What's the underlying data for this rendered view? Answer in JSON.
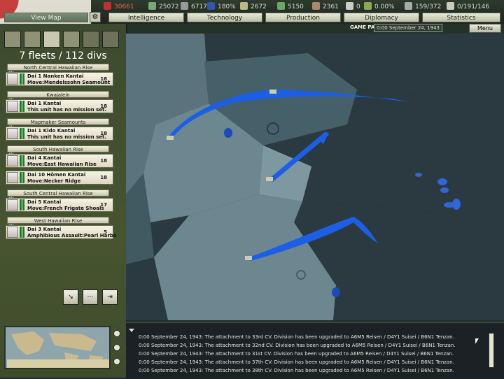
{
  "top": {
    "resources": [
      {
        "name": "manpower",
        "value": "30661",
        "color": "#ff5040"
      },
      {
        "name": "energy",
        "value": "25072",
        "color": "#d4d8c8"
      },
      {
        "name": "metal",
        "value": "67175",
        "color": "#d4d8c8"
      },
      {
        "name": "oil",
        "value": "180%",
        "color": "#d4d8c8"
      },
      {
        "name": "rare-materials",
        "value": "2672",
        "color": "#d4d8c8"
      },
      {
        "name": "money",
        "value": "5150",
        "color": "#d4d8c8"
      },
      {
        "name": "supplies",
        "value": "2361",
        "color": "#d4d8c8"
      },
      {
        "name": "transports",
        "value": "0",
        "color": "#d4d8c8"
      },
      {
        "name": "dissent",
        "value": "0.00%",
        "color": "#d4d8c8"
      },
      {
        "name": "ic",
        "value": "159/372",
        "color": "#d4d8c8"
      },
      {
        "name": "officers",
        "value": "0/191/146",
        "color": "#d4d8c8"
      }
    ],
    "tabs": [
      "View Map",
      "Intelligence",
      "Technology",
      "Production",
      "Diplomacy",
      "Statistics"
    ],
    "status": "GAME PAUSED",
    "date": "0:00 September 24, 1943",
    "menu": "Menu"
  },
  "sidebar": {
    "count": "7 fleets / 112 divs",
    "groups": [
      {
        "region": "North Central Hawaiian Rise",
        "fleets": [
          {
            "name": "Dai 1 Nanken Kantai",
            "mission": "Move:Mendelssohn Seamount",
            "strength": "18"
          }
        ]
      },
      {
        "region": "Kwajalein",
        "fleets": [
          {
            "name": "Dai 1 Kantai",
            "mission": "This unit has no mission set.",
            "strength": "18"
          }
        ]
      },
      {
        "region": "Mapmaker Seamounts",
        "fleets": [
          {
            "name": "Dai 1 Kido Kantai",
            "mission": "This unit has no mission set.",
            "strength": "18"
          }
        ]
      },
      {
        "region": "South Hawaiian Rise",
        "fleets": [
          {
            "name": "Dai 4 Kantai",
            "mission": "Move:East Hawaiian Rise",
            "strength": "18"
          },
          {
            "name": "Dai 10 Hōmen Kantai",
            "mission": "Move:Necker Ridge",
            "strength": "18"
          }
        ]
      },
      {
        "region": "South Central Hawaiian Rise",
        "fleets": [
          {
            "name": "Dai 5 Kantai",
            "mission": "Move:French Frigate Shoals",
            "strength": "17"
          }
        ]
      },
      {
        "region": "West Hawaiian Rise",
        "fleets": [
          {
            "name": "Dai 3 Kantai",
            "mission": "Amphibious Assault:Pearl Harbo",
            "strength": "5"
          }
        ]
      }
    ]
  },
  "log": [
    "0:00 September 24, 1943: The attachment to 33rd CV. Division has been upgraded to A6M5 Reisen / D4Y1 Suisei / B6N1 Tenzan.",
    "0:00 September 24, 1943: The attachment to 32nd CV. Division has been upgraded to A6M5 Reisen / D4Y1 Suisei / B6N1 Tenzan.",
    "0:00 September 24, 1943: The attachment to 31st CV. Division has been upgraded to A6M5 Reisen / D4Y1 Suisei / B6N1 Tenzan.",
    "0:00 September 24, 1943: The attachment to 37th CV. Division has been upgraded to A6M5 Reisen / D4Y1 Suisei / B6N1 Tenzan.",
    "0:00 September 24, 1943: The attachment to 38th CV. Division has been upgraded to A6M5 Reisen / D4Y1 Suisei / B6N1 Tenzan."
  ]
}
